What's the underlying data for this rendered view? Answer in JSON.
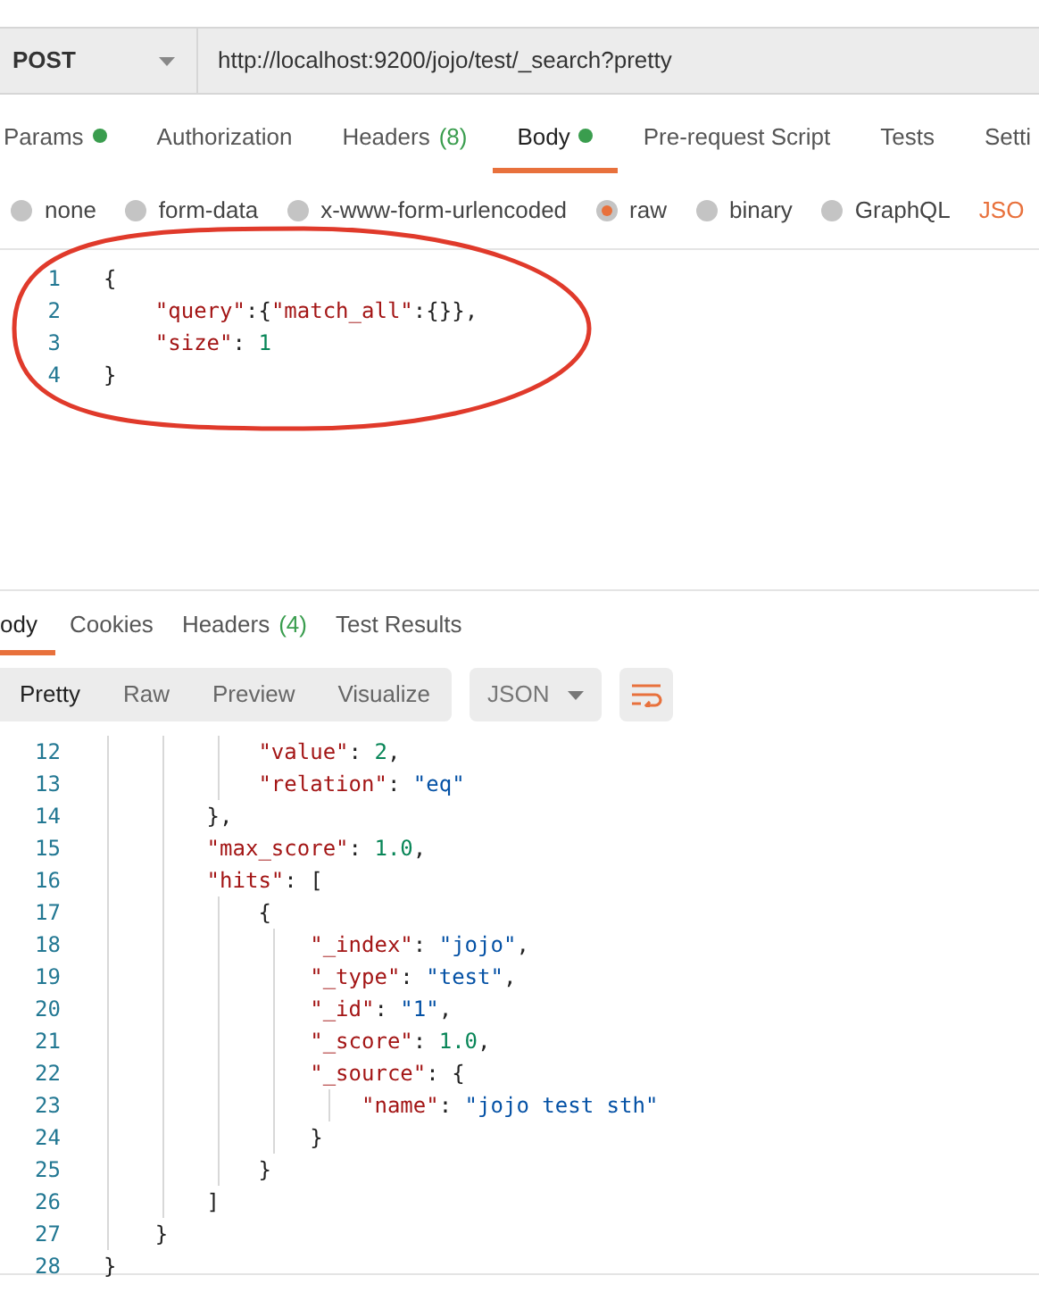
{
  "request": {
    "method": "POST",
    "url": "http://localhost:9200/jojo/test/_search?pretty"
  },
  "request_tabs": [
    {
      "label": "Params",
      "dot": true,
      "selected": false
    },
    {
      "label": "Authorization",
      "dot": false,
      "selected": false
    },
    {
      "label": "Headers",
      "count": "(8)",
      "dot": false,
      "selected": false
    },
    {
      "label": "Body",
      "dot": true,
      "selected": true
    },
    {
      "label": "Pre-request Script",
      "dot": false,
      "selected": false
    },
    {
      "label": "Tests",
      "dot": false,
      "selected": false
    },
    {
      "label": "Setti",
      "dot": false,
      "selected": false
    }
  ],
  "body_types": [
    {
      "label": "none",
      "selected": false
    },
    {
      "label": "form-data",
      "selected": false
    },
    {
      "label": "x-www-form-urlencoded",
      "selected": false
    },
    {
      "label": "raw",
      "selected": true
    },
    {
      "label": "binary",
      "selected": false
    },
    {
      "label": "GraphQL",
      "selected": false
    }
  ],
  "body_format": "JSO",
  "request_body": [
    {
      "number": "1",
      "tokens": [
        {
          "kind": "punct",
          "text": "{"
        }
      ]
    },
    {
      "number": "2",
      "tokens": [
        {
          "kind": "key",
          "text": "    \"query\""
        },
        {
          "kind": "punct",
          "text": ":{"
        },
        {
          "kind": "key",
          "text": "\"match_all\""
        },
        {
          "kind": "punct",
          "text": ":{}},"
        }
      ]
    },
    {
      "number": "3",
      "tokens": [
        {
          "kind": "key",
          "text": "    \"size\""
        },
        {
          "kind": "punct",
          "text": ": "
        },
        {
          "kind": "number",
          "text": "1"
        }
      ]
    },
    {
      "number": "4",
      "tokens": [
        {
          "kind": "punct",
          "text": "}"
        }
      ]
    }
  ],
  "response_tabs": [
    {
      "label": "ody",
      "selected": true
    },
    {
      "label": "Cookies",
      "selected": false
    },
    {
      "label": "Headers",
      "count": "(4)",
      "selected": false
    },
    {
      "label": "Test Results",
      "selected": false
    }
  ],
  "view_modes": [
    {
      "label": "Pretty",
      "selected": true
    },
    {
      "label": "Raw",
      "selected": false
    },
    {
      "label": "Preview",
      "selected": false
    },
    {
      "label": "Visualize",
      "selected": false
    }
  ],
  "response_format": "JSON",
  "response_body": [
    {
      "number": "12",
      "tokens": [
        {
          "kind": "key",
          "text": "            \"value\""
        },
        {
          "kind": "punct",
          "text": ": "
        },
        {
          "kind": "number",
          "text": "2"
        },
        {
          "kind": "punct",
          "text": ","
        }
      ]
    },
    {
      "number": "13",
      "tokens": [
        {
          "kind": "key",
          "text": "            \"relation\""
        },
        {
          "kind": "punct",
          "text": ": "
        },
        {
          "kind": "string",
          "text": "\"eq\""
        }
      ]
    },
    {
      "number": "14",
      "tokens": [
        {
          "kind": "punct",
          "text": "        },"
        }
      ]
    },
    {
      "number": "15",
      "tokens": [
        {
          "kind": "key",
          "text": "        \"max_score\""
        },
        {
          "kind": "punct",
          "text": ": "
        },
        {
          "kind": "number",
          "text": "1.0"
        },
        {
          "kind": "punct",
          "text": ","
        }
      ]
    },
    {
      "number": "16",
      "tokens": [
        {
          "kind": "key",
          "text": "        \"hits\""
        },
        {
          "kind": "punct",
          "text": ": ["
        }
      ]
    },
    {
      "number": "17",
      "tokens": [
        {
          "kind": "punct",
          "text": "            {"
        }
      ]
    },
    {
      "number": "18",
      "tokens": [
        {
          "kind": "key",
          "text": "                \"_index\""
        },
        {
          "kind": "punct",
          "text": ": "
        },
        {
          "kind": "string",
          "text": "\"jojo\""
        },
        {
          "kind": "punct",
          "text": ","
        }
      ]
    },
    {
      "number": "19",
      "tokens": [
        {
          "kind": "key",
          "text": "                \"_type\""
        },
        {
          "kind": "punct",
          "text": ": "
        },
        {
          "kind": "string",
          "text": "\"test\""
        },
        {
          "kind": "punct",
          "text": ","
        }
      ]
    },
    {
      "number": "20",
      "tokens": [
        {
          "kind": "key",
          "text": "                \"_id\""
        },
        {
          "kind": "punct",
          "text": ": "
        },
        {
          "kind": "string",
          "text": "\"1\""
        },
        {
          "kind": "punct",
          "text": ","
        }
      ]
    },
    {
      "number": "21",
      "tokens": [
        {
          "kind": "key",
          "text": "                \"_score\""
        },
        {
          "kind": "punct",
          "text": ": "
        },
        {
          "kind": "number",
          "text": "1.0"
        },
        {
          "kind": "punct",
          "text": ","
        }
      ]
    },
    {
      "number": "22",
      "tokens": [
        {
          "kind": "key",
          "text": "                \"_source\""
        },
        {
          "kind": "punct",
          "text": ": {"
        }
      ]
    },
    {
      "number": "23",
      "tokens": [
        {
          "kind": "key",
          "text": "                    \"name\""
        },
        {
          "kind": "punct",
          "text": ": "
        },
        {
          "kind": "string",
          "text": "\"jojo test sth\""
        }
      ]
    },
    {
      "number": "24",
      "tokens": [
        {
          "kind": "punct",
          "text": "                }"
        }
      ]
    },
    {
      "number": "25",
      "tokens": [
        {
          "kind": "punct",
          "text": "            }"
        }
      ]
    },
    {
      "number": "26",
      "tokens": [
        {
          "kind": "punct",
          "text": "        ]"
        }
      ]
    },
    {
      "number": "27",
      "tokens": [
        {
          "kind": "punct",
          "text": "    }"
        }
      ]
    },
    {
      "number": "28",
      "tokens": [
        {
          "kind": "punct",
          "text": "}"
        }
      ]
    }
  ]
}
